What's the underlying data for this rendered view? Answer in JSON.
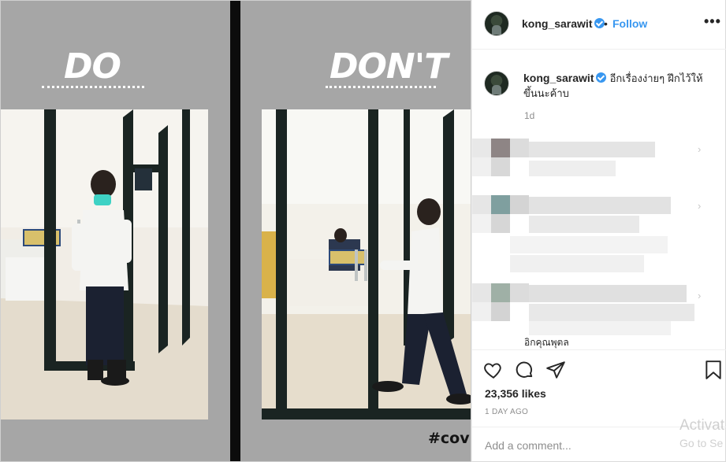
{
  "post": {
    "left_panel": {
      "title": "DO"
    },
    "right_panel": {
      "title": "DON'T"
    },
    "hashtag": "#covic"
  },
  "header": {
    "username": "kong_sarawit",
    "separator": "•",
    "follow_label": "Follow",
    "more_label": "•••"
  },
  "caption": {
    "username": "kong_sarawit",
    "text": "อีกเรื่องง่ายๆ ฝึกไว้ให้ขึ้นนะค้าบ",
    "time": "1d"
  },
  "comments": {
    "truncated_text": "อิกคุณพุตล",
    "reply_indicator": "›"
  },
  "actions": {
    "likes": "23,356 likes",
    "posted_ago": "1 DAY AGO"
  },
  "comment_box": {
    "placeholder": "Add a comment..."
  },
  "overlay": {
    "activation_line1": "Activat",
    "activation_line2": "Go to Se"
  },
  "colors": {
    "accent": "#3897f0",
    "panel_gray": "#a6a6a6",
    "divider": "#0c0c0c"
  },
  "icons": [
    "verified-badge-icon",
    "more-options-icon",
    "heart-icon",
    "comment-icon",
    "share-icon",
    "bookmark-icon"
  ]
}
